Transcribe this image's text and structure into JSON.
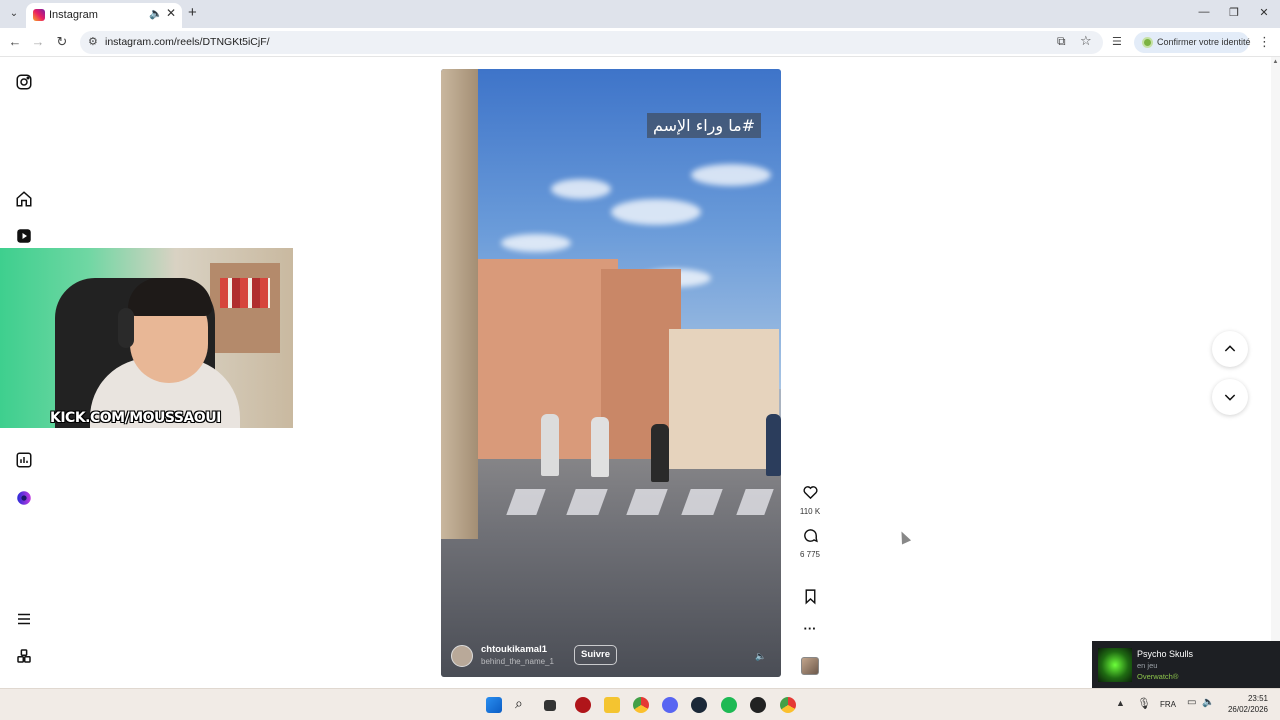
{
  "browser": {
    "tab": {
      "title": "Instagram",
      "audio_icon": "speaker-icon",
      "close_icon": "close-icon"
    },
    "new_tab_icon": "plus-icon",
    "window_controls": [
      "minimize-icon",
      "maximize-icon",
      "close-icon"
    ],
    "address": {
      "url": "instagram.com/reels/DTNGKt5iCjF/"
    },
    "identity_chip": "Confirmer votre identité"
  },
  "sidebar": {
    "icons": [
      "instagram-logo-icon",
      "home-icon",
      "reels-icon",
      "stats-icon",
      "meta-ai-icon",
      "menu-icon",
      "more-apps-icon"
    ]
  },
  "webcam": {
    "banner": "KICK.COM/MOUSSAOUI"
  },
  "reel": {
    "overlay_hashtag": "#ما وراء الإسم",
    "username": "chtoukikamal1",
    "audio": "behind_the_name_1",
    "follow_label": "Suivre",
    "mute_icon": "speaker-icon"
  },
  "actions": {
    "likes": "110 K",
    "comments": "6 775"
  },
  "notification": {
    "title": "Psycho Skulls",
    "status": "en jeu",
    "game": "Overwatch®"
  },
  "taskbar": {
    "lang": "FRA",
    "time": "23:51",
    "date": "26/02/2026"
  }
}
